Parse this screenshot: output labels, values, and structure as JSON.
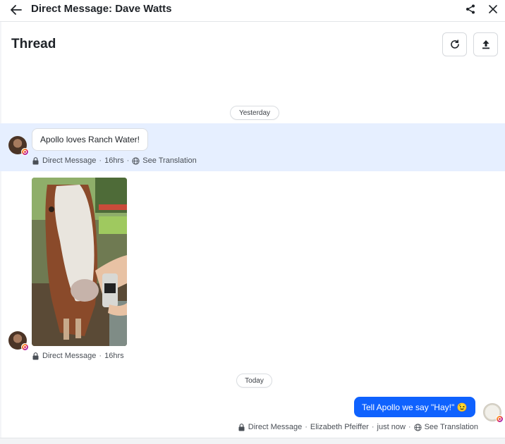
{
  "header": {
    "title": "Direct Message: Dave Watts",
    "back_icon": "arrow-left-icon",
    "share_icon": "share-icon",
    "close_icon": "close-icon"
  },
  "thread": {
    "title": "Thread",
    "refresh_icon": "refresh-icon",
    "export_icon": "upload-icon"
  },
  "day_labels": {
    "yesterday": "Yesterday",
    "today": "Today"
  },
  "messages": [
    {
      "direction": "incoming",
      "text": "Apollo loves Ranch Water!",
      "channel": "Direct Message",
      "time": "16hrs",
      "translation": "See Translation",
      "highlighted": true
    },
    {
      "direction": "incoming",
      "attachment": "image",
      "channel": "Direct Message",
      "time": "16hrs"
    },
    {
      "direction": "outgoing",
      "text": "Tell Apollo we say \"Hay!\" 😉",
      "channel": "Direct Message",
      "author": "Elizabeth Pfeiffer",
      "time": "just now",
      "translation": "See Translation"
    }
  ],
  "separator": "·",
  "colors": {
    "accent": "#0f62fe",
    "highlight": "#e6efff"
  }
}
